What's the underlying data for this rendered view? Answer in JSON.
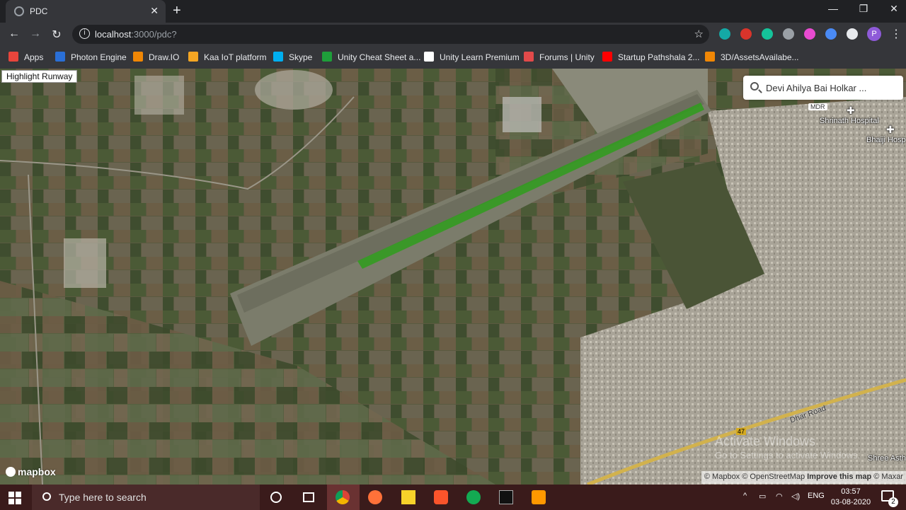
{
  "browser": {
    "tab_title": "PDC",
    "tab_close": "✕",
    "new_tab": "+",
    "window": {
      "minimize": "—",
      "maximize": "❐",
      "close": "✕"
    },
    "url_host": "localhost",
    "url_path": ":3000/pdc?",
    "bookmarks": [
      {
        "label": "Apps",
        "icon": "apps-grid-icon",
        "color": "#e8453c"
      },
      {
        "label": "Photon Engine",
        "icon": "photon-icon",
        "color": "#2a6fd6"
      },
      {
        "label": "Draw.IO",
        "icon": "drawio-icon",
        "color": "#f08705"
      },
      {
        "label": "Kaa IoT platform",
        "icon": "kaa-icon",
        "color": "#f5a623"
      },
      {
        "label": "Skype",
        "icon": "skype-icon",
        "color": "#00aff0"
      },
      {
        "label": "Unity Cheat Sheet a...",
        "icon": "unity-sheet-icon",
        "color": "#1e9e3a"
      },
      {
        "label": "Unity Learn Premium",
        "icon": "unity-icon",
        "color": "#ffffff"
      },
      {
        "label": "Forums | Unity",
        "icon": "forums-icon",
        "color": "#e24a4a"
      },
      {
        "label": "Startup Pathshala 2...",
        "icon": "youtube-icon",
        "color": "#ff0000"
      },
      {
        "label": "3D/AssetsAvailabe...",
        "icon": "drawio-icon",
        "color": "#f08705"
      }
    ],
    "extensions": [
      {
        "icon": "extension-m-icon",
        "color": "#14a9a6"
      },
      {
        "icon": "extension-book-icon",
        "color": "#d9342b"
      },
      {
        "icon": "grammarly-icon",
        "color": "#15c39a"
      },
      {
        "icon": "extension-cloud-icon",
        "color": "#9aa0a6"
      },
      {
        "icon": "extension-color-icon",
        "color": "#e84bd1"
      },
      {
        "icon": "extension-translate-icon",
        "color": "#4a8af4"
      },
      {
        "icon": "extensions-puzzle-icon",
        "color": "#e8eaed"
      }
    ],
    "profile_initial": "P"
  },
  "map": {
    "highlight_button": "Highlight Runway",
    "search_value": "Devi Ahilya Bai Holkar ...",
    "logo": "mapbox",
    "attribution_prefix": "© Mapbox © OpenStreetMap",
    "attribution_improve": "Improve this map",
    "attribution_suffix": "© Maxar",
    "labels": {
      "mdr": "MDR",
      "shrinath": "Shrinath Hospital",
      "bhaiji": "Bhaiji Hosp",
      "dhar_road": "Dhar Road",
      "shree_asth": "Shree Asth",
      "shield_47": "47"
    },
    "runway_color": "#2f9e1c",
    "watermark_title": "Activate Windows",
    "watermark_sub": "Go to Settings to activate Windows."
  },
  "taskbar": {
    "search_placeholder": "Type here to search",
    "language": "ENG",
    "time": "03:57",
    "date": "03-08-2020",
    "notification_count": "2"
  }
}
